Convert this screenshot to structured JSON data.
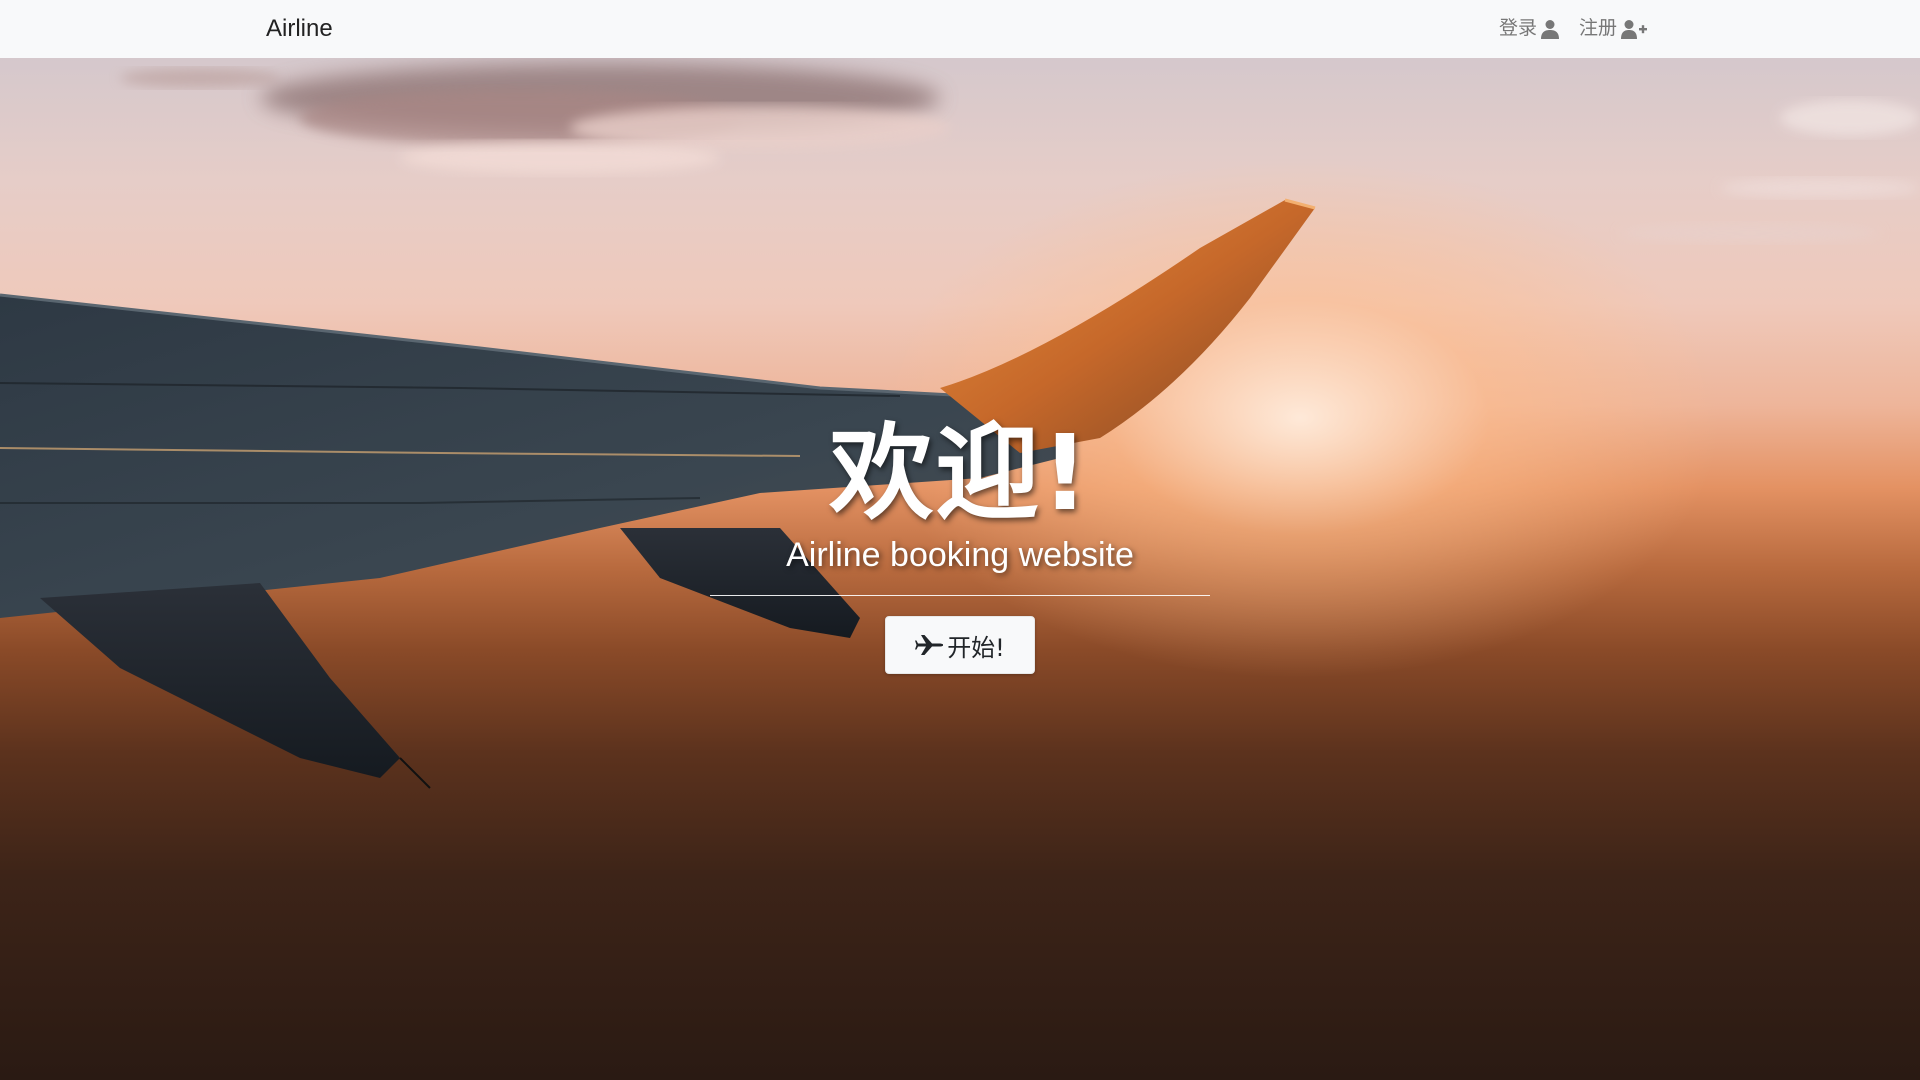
{
  "navbar": {
    "brand": "Airline",
    "login_label": "登录",
    "register_label": "注册",
    "login_icon": "user-icon",
    "register_icon": "user-plus-icon"
  },
  "hero": {
    "title": "欢迎!",
    "subtitle": "Airline booking website",
    "button_label": "开始!",
    "button_icon": "plane-icon",
    "background": "sunset-airplane-wing-photo"
  },
  "colors": {
    "navbar_bg": "#f8f9fa",
    "brand_text": "#222222",
    "nav_link_text": "#777777",
    "hero_text": "#ffffff",
    "button_bg": "#f8f9fa"
  }
}
